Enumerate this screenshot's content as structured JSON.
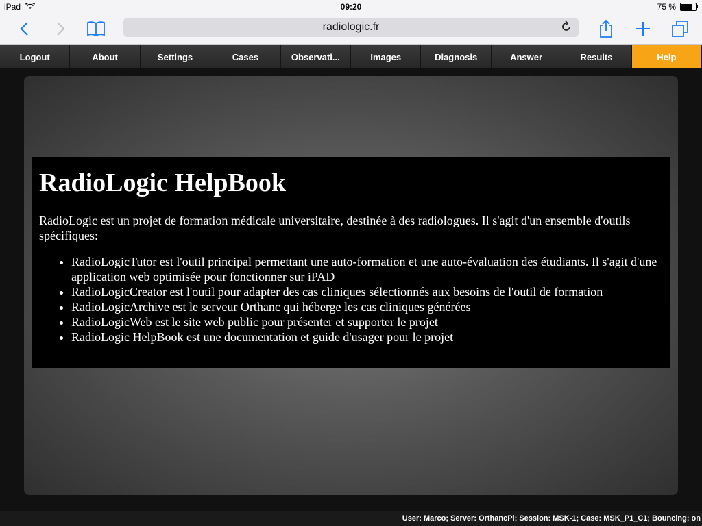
{
  "statusbar": {
    "device": "iPad",
    "time": "09:20",
    "battery": "75 %",
    "battery_level": 0.75
  },
  "browser": {
    "url": "radiologic.fr",
    "icons": [
      "back-icon",
      "forward-icon",
      "bookmarks-icon",
      "reload-icon",
      "share-icon",
      "new-tab-icon",
      "tabs-icon"
    ]
  },
  "nav": {
    "items": [
      {
        "label": "Logout"
      },
      {
        "label": "About"
      },
      {
        "label": "Settings"
      },
      {
        "label": "Cases"
      },
      {
        "label": "Observati..."
      },
      {
        "label": "Images"
      },
      {
        "label": "Diagnosis"
      },
      {
        "label": "Answer"
      },
      {
        "label": "Results"
      },
      {
        "label": "Help"
      }
    ],
    "active": "Help",
    "active_color": "#f7a416"
  },
  "help": {
    "title": "RadioLogic HelpBook",
    "intro": "RadioLogic est un projet de formation médicale universitaire, destinée à des radiologues. Il s'agit d'un ensemble d'outils spécifiques:",
    "items": [
      "RadioLogicTutor est l'outil principal permettant une auto-formation et une auto-évaluation des étudiants. Il s'agit d'une application web optimisée pour fonctionner sur iPAD",
      "RadioLogicCreator est l'outil pour adapter des cas cliniques sélectionnés aux besoins de l'outil de formation",
      "RadioLogicArchive est le serveur Orthanc qui héberge les cas cliniques générées",
      "RadioLogicWeb est le site web public pour présenter et supporter le projet",
      "RadioLogic HelpBook est une documentation et guide d'usager pour le projet"
    ]
  },
  "footer": {
    "status": "User: Marco; Server: OrthancPi; Session: MSK-1; Case: MSK_P1_C1; Bouncing: on"
  }
}
